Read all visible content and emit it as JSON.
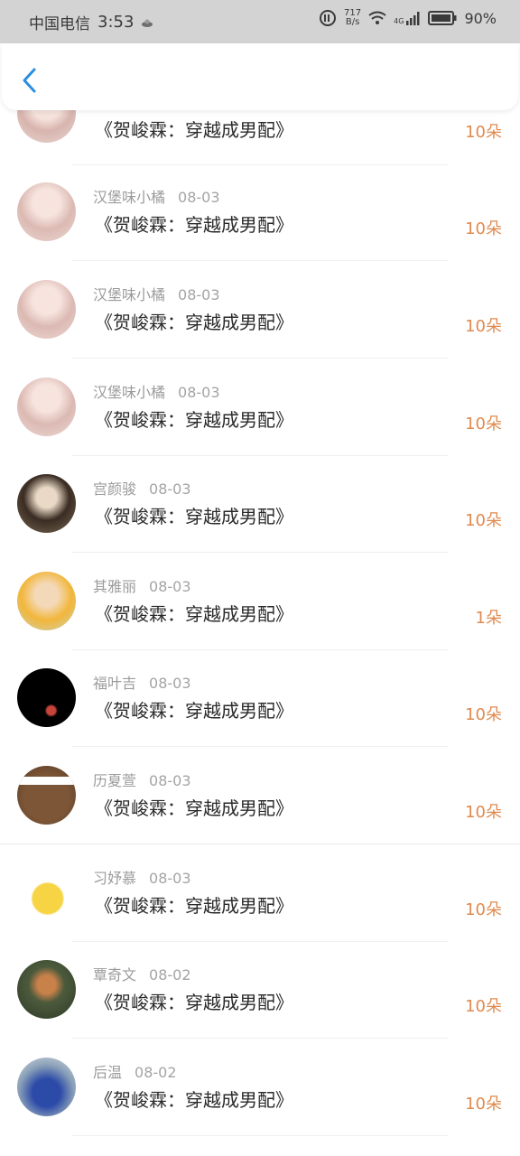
{
  "status_bar": {
    "carrier": "中国电信",
    "time": "3:53",
    "speed_value": "717",
    "speed_unit": "B/s",
    "network": "4G",
    "battery": "90%"
  },
  "header": {
    "back_icon": "chevron-left-icon",
    "accent": "#2a8fe0"
  },
  "colors": {
    "amount": "#e08a4f",
    "name": "#9b9b9b",
    "title": "#2a2a2a"
  },
  "rows": [
    {
      "name": "",
      "date": "",
      "title": "《贺峻霖：穿越成男配》",
      "amount": "10朵"
    },
    {
      "name": "汉堡味小橘",
      "date": "08-03",
      "title": "《贺峻霖：穿越成男配》",
      "amount": "10朵"
    },
    {
      "name": "汉堡味小橘",
      "date": "08-03",
      "title": "《贺峻霖：穿越成男配》",
      "amount": "10朵"
    },
    {
      "name": "汉堡味小橘",
      "date": "08-03",
      "title": "《贺峻霖：穿越成男配》",
      "amount": "10朵"
    },
    {
      "name": "宫颜骏",
      "date": "08-03",
      "title": "《贺峻霖：穿越成男配》",
      "amount": "10朵"
    },
    {
      "name": "其雅丽",
      "date": "08-03",
      "title": "《贺峻霖：穿越成男配》",
      "amount": "1朵"
    },
    {
      "name": "福叶吉",
      "date": "08-03",
      "title": "《贺峻霖：穿越成男配》",
      "amount": "10朵"
    },
    {
      "name": "历夏萱",
      "date": "08-03",
      "title": "《贺峻霖：穿越成男配》",
      "amount": "10朵"
    },
    {
      "name": "习妤慕",
      "date": "08-03",
      "title": "《贺峻霖：穿越成男配》",
      "amount": "10朵"
    },
    {
      "name": "覃奇文",
      "date": "08-02",
      "title": "《贺峻霖：穿越成男配》",
      "amount": "10朵"
    },
    {
      "name": "后温",
      "date": "08-02",
      "title": "《贺峻霖：穿越成男配》",
      "amount": "10朵"
    }
  ]
}
